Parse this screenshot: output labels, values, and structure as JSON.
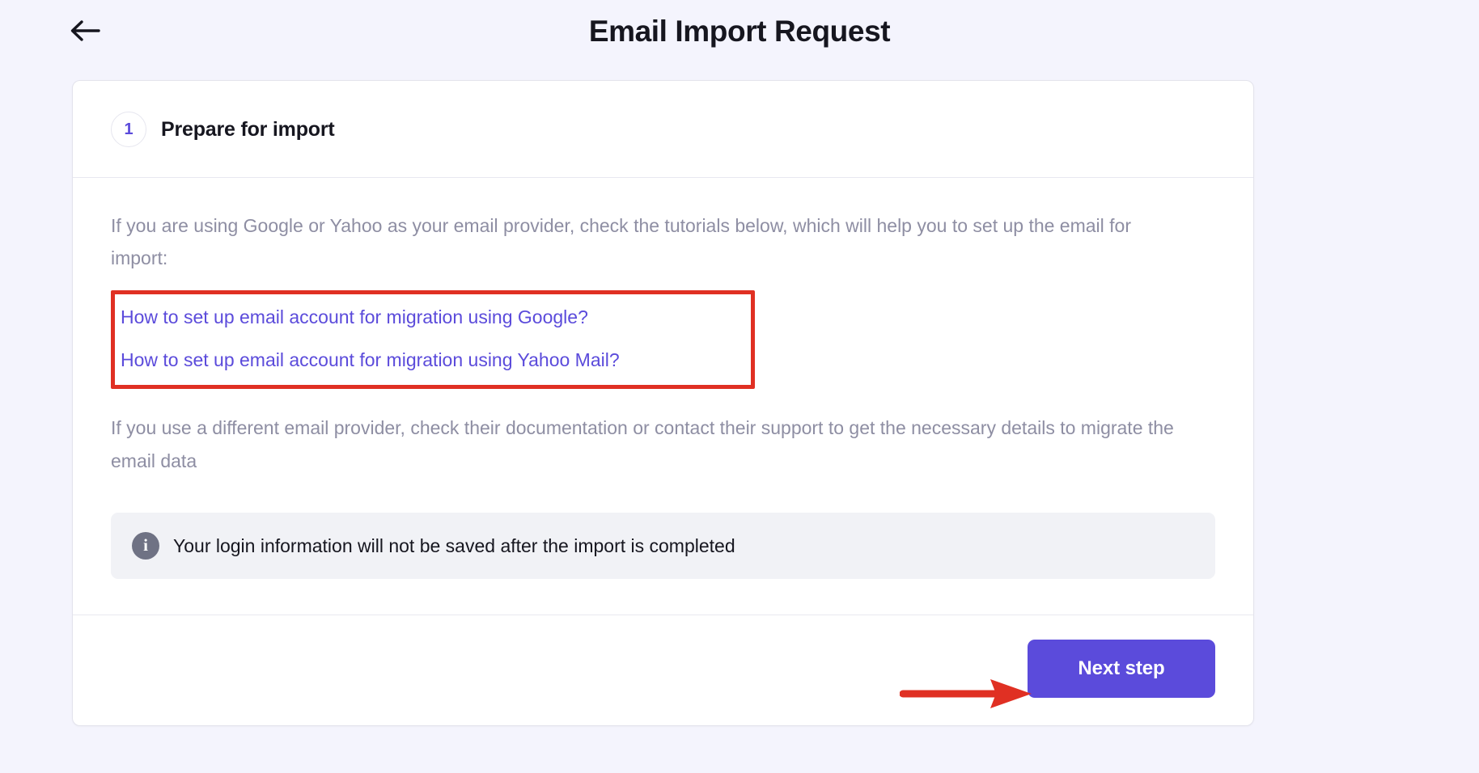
{
  "header": {
    "back_icon": "arrow-left-icon",
    "title": "Email Import Request"
  },
  "card": {
    "step": {
      "number": "1",
      "title": "Prepare for import"
    },
    "intro_text": "If you are using Google or Yahoo as your email provider, check the tutorials below, which will help you to set up the email for import:",
    "links": [
      {
        "label": "How to set up email account for migration using Google?"
      },
      {
        "label": "How to set up email account for migration using Yahoo Mail?"
      }
    ],
    "secondary_text": "If you use a different email provider, check their documentation or contact their support to get the necessary details to migrate the email data",
    "notice": {
      "icon": "info-icon",
      "text": "Your login information will not be saved after the import is completed"
    },
    "footer": {
      "next_label": "Next step"
    }
  },
  "annotations": {
    "highlight_color": "#e03023",
    "arrow_color": "#e03023"
  },
  "colors": {
    "accent": "#5b4bdb",
    "page_background": "#f4f4fd",
    "card_background": "#ffffff",
    "muted_text": "#8e8ea3",
    "notice_background": "#f1f2f6"
  }
}
